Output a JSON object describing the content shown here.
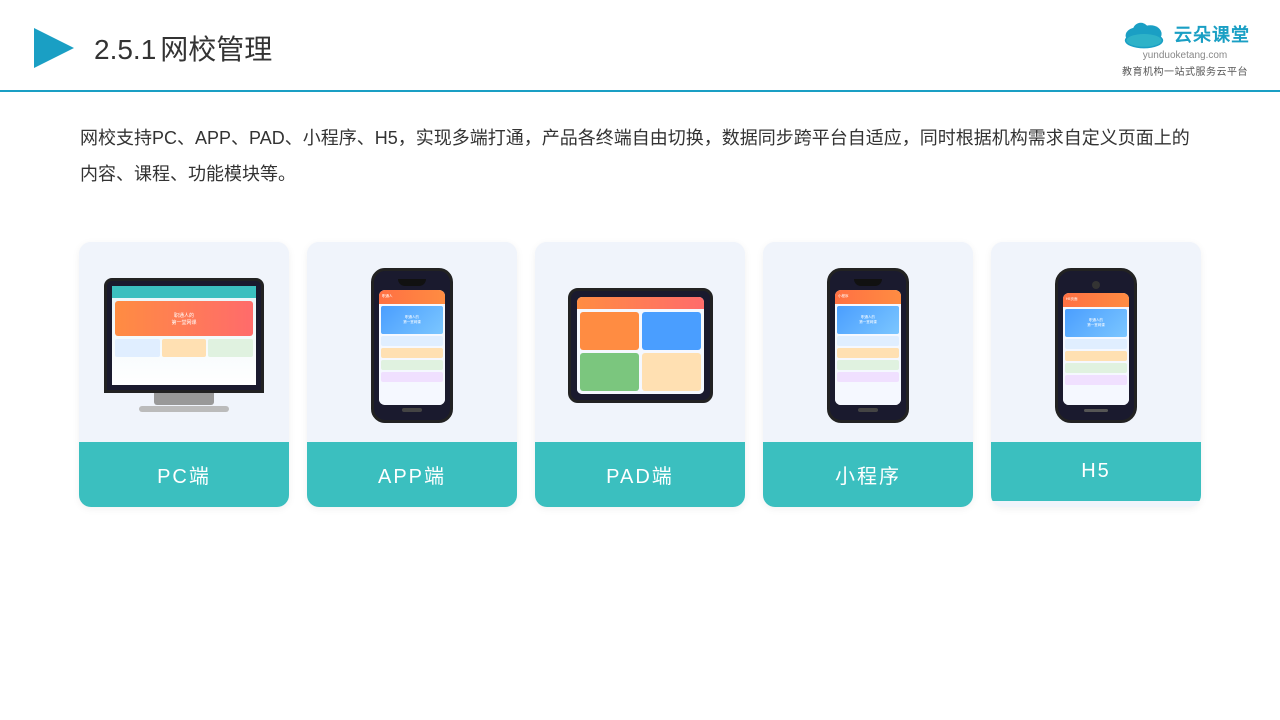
{
  "header": {
    "title": "网校管理",
    "title_prefix": "2.5.1",
    "logo_text": "云朵课堂",
    "logo_url": "yunduoketang.com",
    "logo_tagline": "教育机构一站\n式服务云平台"
  },
  "description": {
    "text": "网校支持PC、APP、PAD、小程序、H5，实现多端打通，产品各终端自由切换，数据同步跨平台自适应，同时根据机构需求自定义页面上的内容、课程、功能模块等。"
  },
  "cards": [
    {
      "id": "pc",
      "label": "PC端"
    },
    {
      "id": "app",
      "label": "APP端"
    },
    {
      "id": "pad",
      "label": "PAD端"
    },
    {
      "id": "mini",
      "label": "小程序"
    },
    {
      "id": "h5",
      "label": "H5"
    }
  ]
}
